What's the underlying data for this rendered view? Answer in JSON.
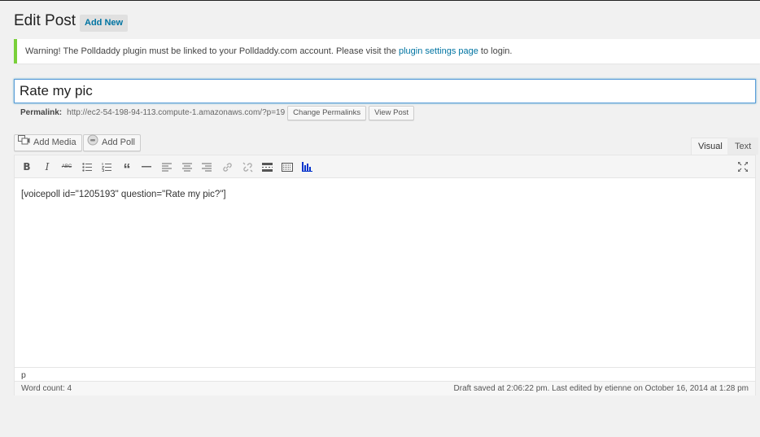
{
  "header": {
    "title": "Edit Post",
    "add_new_label": "Add New"
  },
  "notice": {
    "text_before": "Warning! The Polldaddy plugin must be linked to your Polldaddy.com account. Please visit the ",
    "link_text": "plugin settings page",
    "text_after": " to login.",
    "accent_color": "#7ad03a"
  },
  "post": {
    "title": "Rate my pic"
  },
  "permalink": {
    "label": "Permalink:",
    "url": "http://ec2-54-198-94-113.compute-1.amazonaws.com/?p=19",
    "change_label": "Change Permalinks",
    "view_label": "View Post"
  },
  "media_buttons": {
    "add_media_label": "Add Media",
    "add_poll_label": "Add Poll"
  },
  "editor_tabs": {
    "visual": "Visual",
    "text": "Text"
  },
  "toolbar": {
    "bold": "B",
    "italic": "I",
    "strikethrough": "ABC",
    "blockquote": "“",
    "icons": [
      "bold-icon",
      "italic-icon",
      "strikethrough-icon",
      "bullet-list-icon",
      "numbered-list-icon",
      "blockquote-icon",
      "horizontal-rule-icon",
      "align-left-icon",
      "align-center-icon",
      "align-right-icon",
      "link-icon",
      "unlink-icon",
      "read-more-icon",
      "toolbar-toggle-icon",
      "polldaddy-icon",
      "fullscreen-icon"
    ]
  },
  "editor": {
    "content": "[voicepoll id=\"1205193\" question=\"Rate my pic?\"]",
    "path": "p",
    "word_count": "Word count: 4",
    "status": "Draft saved at 2:06:22 pm. Last edited by etienne on October 16, 2014 at 1:28 pm"
  }
}
